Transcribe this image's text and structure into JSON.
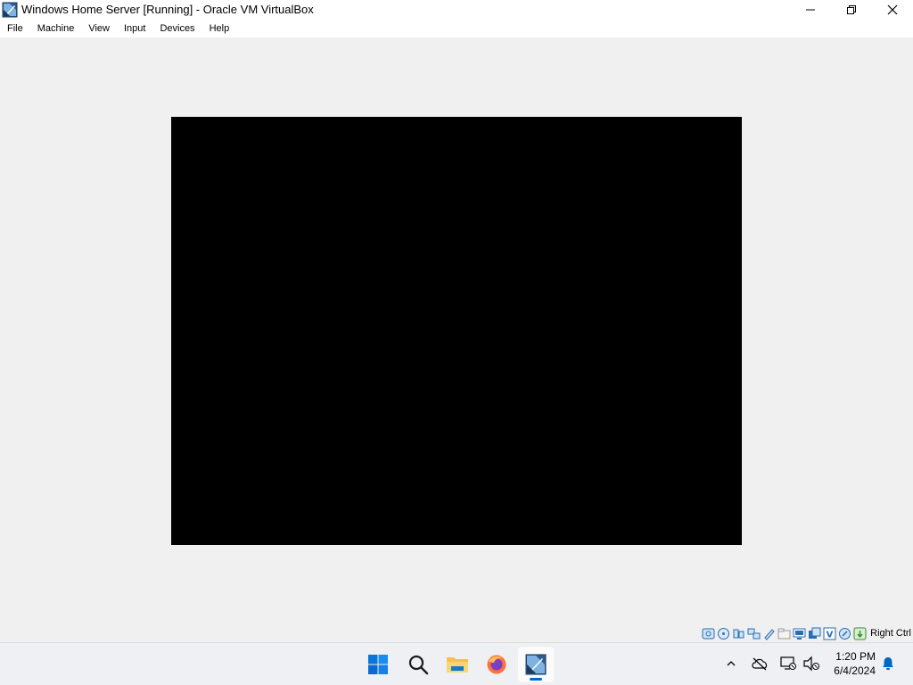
{
  "window": {
    "title": "Windows Home Server [Running] - Oracle VM VirtualBox",
    "app_icon": "virtualbox-icon",
    "controls": {
      "minimize": "—",
      "maximize": "❐",
      "close": "✕"
    }
  },
  "menubar": {
    "items": [
      {
        "label": "File"
      },
      {
        "label": "Machine"
      },
      {
        "label": "View"
      },
      {
        "label": "Input"
      },
      {
        "label": "Devices"
      },
      {
        "label": "Help"
      }
    ]
  },
  "vm": {
    "screen_color": "#000000"
  },
  "statusbar": {
    "icons": [
      "hard-disk-icon",
      "optical-drive-icon",
      "audio-icon",
      "network-icon",
      "usb-icon",
      "shared-folders-icon",
      "display-icon",
      "video-capture-icon",
      "virtualization-icon",
      "mouse-integration-icon",
      "keyboard-icon"
    ],
    "host_key": "Right Ctrl"
  },
  "taskbar": {
    "apps": [
      {
        "name": "start-icon"
      },
      {
        "name": "search-icon"
      },
      {
        "name": "file-explorer-icon"
      },
      {
        "name": "firefox-icon"
      },
      {
        "name": "virtualbox-icon",
        "active": true
      }
    ],
    "tray": {
      "overflow_icon": "chevron-up-icon",
      "onedrive_icon": "cloud-offline-icon",
      "network_icon": "network-disconnected-icon",
      "sound_icon": "speaker-muted-icon",
      "time": "1:20 PM",
      "date": "6/4/2024",
      "notification_icon": "bell-icon"
    }
  },
  "colors": {
    "accent": "#0067c0",
    "window_bg": "#f0f0f0",
    "titlebar_bg": "#ffffff"
  }
}
